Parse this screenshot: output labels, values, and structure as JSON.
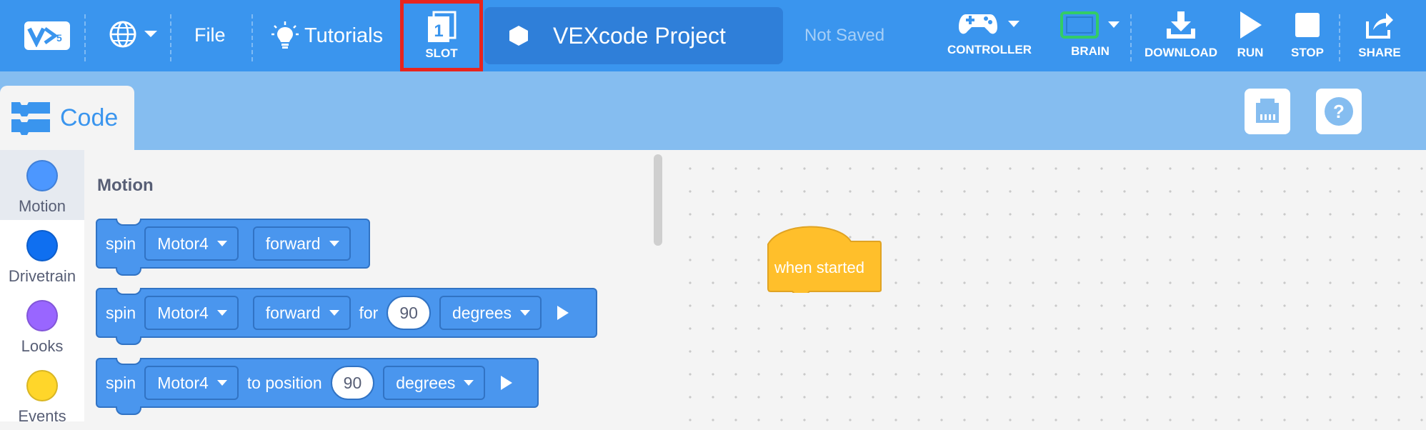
{
  "topbar": {
    "file_label": "File",
    "tutorials_label": "Tutorials",
    "slot_number": "1",
    "slot_label": "SLOT",
    "project_name": "VEXcode Project",
    "save_status": "Not Saved",
    "controller_label": "CONTROLLER",
    "brain_label": "BRAIN",
    "download_label": "DOWNLOAD",
    "run_label": "RUN",
    "stop_label": "STOP",
    "share_label": "SHARE"
  },
  "subbar": {
    "code_tab_label": "Code"
  },
  "categories": [
    {
      "label": "Motion",
      "color": "#4c97ff"
    },
    {
      "label": "Drivetrain",
      "color": "#0f6ff0"
    },
    {
      "label": "Looks",
      "color": "#9966ff"
    },
    {
      "label": "Events",
      "color": "#ffd62a"
    }
  ],
  "palette": {
    "section_title": "Motion",
    "block1": {
      "verb": "spin",
      "motor": "Motor4",
      "direction": "forward"
    },
    "block2": {
      "verb": "spin",
      "motor": "Motor4",
      "direction": "forward",
      "for_label": "for",
      "amount": "90",
      "units": "degrees"
    },
    "block3": {
      "verb": "spin",
      "motor": "Motor4",
      "to_label": "to position",
      "amount": "90",
      "units": "degrees"
    }
  },
  "workspace": {
    "hat_label": "when started",
    "hat_color": "#ffbf2b"
  },
  "colors": {
    "topbar": "#3a95ee",
    "subbar": "#85bdf0",
    "motion_block": "#4a96ee",
    "brain_accent": "#33cc66"
  }
}
